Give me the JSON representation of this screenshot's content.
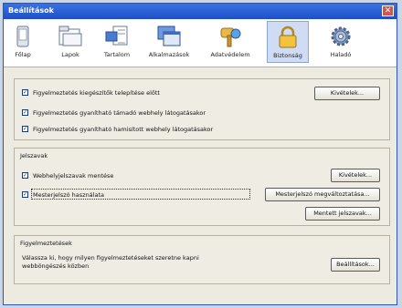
{
  "window": {
    "title": "Beállítások",
    "close_label": "✕"
  },
  "tabs": [
    {
      "label": "Főlap",
      "icon": "phone-icon"
    },
    {
      "label": "Lapok",
      "icon": "folder-icon"
    },
    {
      "label": "Tartalom",
      "icon": "content-icon"
    },
    {
      "label": "Alkalmazások",
      "icon": "windows-icon"
    },
    {
      "label": "Adatvédelem",
      "icon": "key-icon"
    },
    {
      "label": "Biztonság",
      "icon": "lock-icon",
      "active": true
    },
    {
      "label": "Haladó",
      "icon": "gear-icon"
    }
  ],
  "section1": {
    "rows": [
      {
        "label": "Figyelmeztetés kiegészítők telepítése előtt",
        "checked": true
      },
      {
        "label": "Figyelmeztetés gyanítható támadó webhely látogatásakor",
        "checked": true
      },
      {
        "label": "Figyelmeztetés gyanítható hamisított webhely látogatásakor",
        "checked": true
      }
    ],
    "exceptions_button": "Kivételek..."
  },
  "passwords": {
    "legend": "Jelszavak",
    "save_label": "Webhelyjelszavak mentése",
    "save_checked": true,
    "master_label": "Mesterjelszó használata",
    "master_checked": true,
    "exceptions_button": "Kivételek...",
    "change_master_button": "Mesterjelszó megváltoztatása...",
    "saved_button": "Mentett jelszavak..."
  },
  "warnings": {
    "legend": "Figyelmeztetések",
    "text": "Válassza ki, hogy milyen figyelmeztetéseket szeretne kapni webböngészés közben",
    "settings_button": "Beállítások..."
  }
}
